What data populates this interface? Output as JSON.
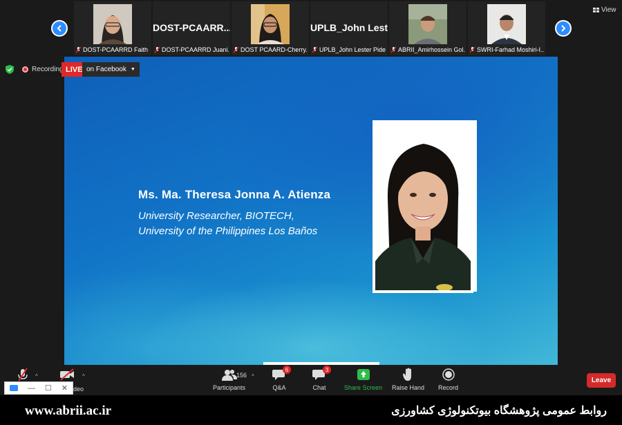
{
  "gallery": {
    "tiles": [
      {
        "caption": "DOST-PCAARRD Faith ...",
        "type": "photo"
      },
      {
        "caption": "DOST-PCAARRD Juani...",
        "big_name": "DOST-PCAARR...",
        "type": "name"
      },
      {
        "caption": "DOST PCAARD-Cherry...",
        "type": "photo"
      },
      {
        "caption": "UPLB_John Lester Pide",
        "big_name": "UPLB_John Lest...",
        "type": "name"
      },
      {
        "caption": "ABRII_Amirhossein Gol...",
        "type": "photo"
      },
      {
        "caption": "SWRI-Farhad Moshiri-I...",
        "type": "photo"
      }
    ],
    "view_label": "View"
  },
  "status": {
    "recording_label": "Recording",
    "live_label": "LIVE",
    "live_target": "on Facebook"
  },
  "slide": {
    "name": "Ms. Ma. Theresa Jonna A. Atienza",
    "role_line1": "University Researcher, BIOTECH,",
    "role_line2": "University of the Philippines Los Baños"
  },
  "toolbar": {
    "video_label": "ideo",
    "participants_label": "Participants",
    "participants_count": "156",
    "qa_label": "Q&A",
    "qa_badge": "6",
    "chat_label": "Chat",
    "chat_badge": "3",
    "share_label": "Share Screen",
    "raise_label": "Raise Hand",
    "record_label": "Record",
    "leave_label": "Leave"
  },
  "footer": {
    "url": "www.abrii.ac.ir",
    "org": "روابط عمومی پژوهشگاه بیوتکنولوژی کشاورزی"
  },
  "colors": {
    "accent": "#2d8cff",
    "live": "#e02828",
    "share_green": "#2fbd4a",
    "leave": "#d42a2a"
  }
}
